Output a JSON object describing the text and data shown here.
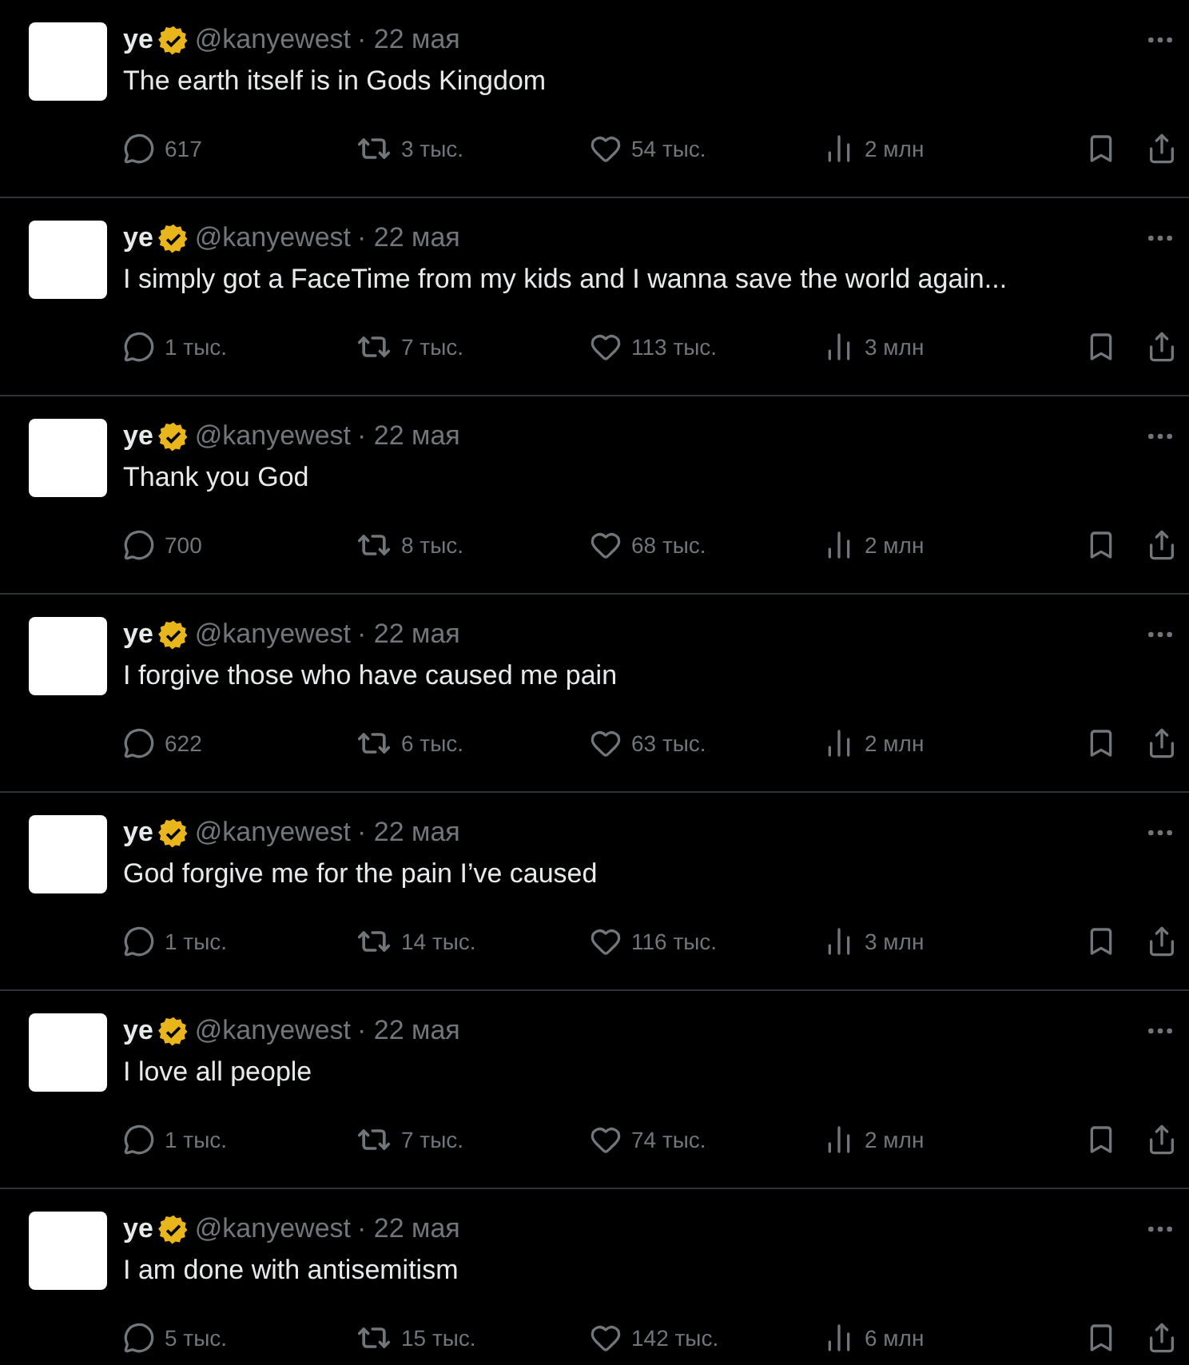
{
  "tweets": [
    {
      "name": "ye",
      "handle": "@kanyewest",
      "date": "· 22 мая",
      "text": "The earth itself is in Gods Kingdom",
      "replies": "617",
      "reposts": "3 тыс.",
      "likes": "54 тыс.",
      "views": "2 млн"
    },
    {
      "name": "ye",
      "handle": "@kanyewest",
      "date": "· 22 мая",
      "text": "I simply got a FaceTime from my kids and I wanna save the world again...",
      "replies": "1 тыс.",
      "reposts": "7 тыс.",
      "likes": "113 тыс.",
      "views": "3 млн"
    },
    {
      "name": "ye",
      "handle": "@kanyewest",
      "date": "· 22 мая",
      "text": "Thank you God",
      "replies": "700",
      "reposts": "8 тыс.",
      "likes": "68 тыс.",
      "views": "2 млн"
    },
    {
      "name": "ye",
      "handle": "@kanyewest",
      "date": "· 22 мая",
      "text": "I forgive those who have caused me pain",
      "replies": "622",
      "reposts": "6 тыс.",
      "likes": "63 тыс.",
      "views": "2 млн"
    },
    {
      "name": "ye",
      "handle": "@kanyewest",
      "date": "· 22 мая",
      "text": "God forgive me for the pain I’ve caused",
      "replies": "1 тыс.",
      "reposts": "14 тыс.",
      "likes": "116 тыс.",
      "views": "3 млн"
    },
    {
      "name": "ye",
      "handle": "@kanyewest",
      "date": "· 22 мая",
      "text": "I love all people",
      "replies": "1 тыс.",
      "reposts": "7 тыс.",
      "likes": "74 тыс.",
      "views": "2 млн"
    },
    {
      "name": "ye",
      "handle": "@kanyewest",
      "date": "· 22 мая",
      "text": "I am done with antisemitism",
      "replies": "5 тыс.",
      "reposts": "15 тыс.",
      "likes": "142 тыс.",
      "views": "6 млн"
    }
  ]
}
